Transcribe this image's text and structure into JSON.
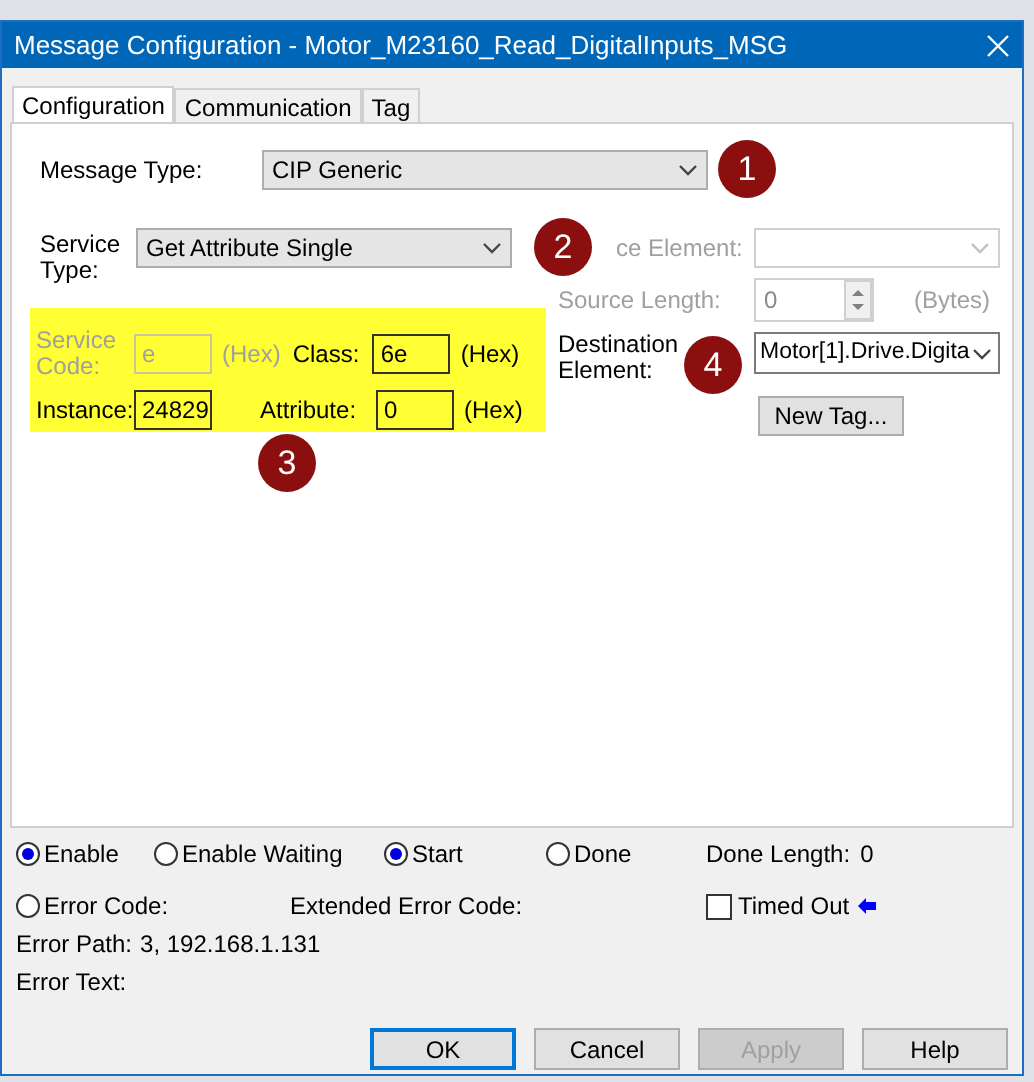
{
  "window": {
    "title": "Message Configuration - Motor_M23160_Read_DigitalInputs_MSG"
  },
  "tabs": [
    {
      "label": "Configuration",
      "selected": true
    },
    {
      "label": "Communication",
      "selected": false
    },
    {
      "label": "Tag",
      "selected": false
    }
  ],
  "message_type": {
    "label": "Message Type:",
    "value": "CIP Generic"
  },
  "service_type": {
    "label": "Service Type:",
    "value": "Get Attribute Single"
  },
  "parameters": [
    {
      "label": "Service Code:",
      "value": "e",
      "unit": "(Hex)",
      "disabled": true
    },
    {
      "label": "Class:",
      "value": "6e",
      "unit": "(Hex)",
      "disabled": false
    },
    {
      "label": "Instance:",
      "value": "24829",
      "disabled": false
    },
    {
      "label": "Attribute:",
      "value": "0",
      "unit": "(Hex)",
      "disabled": false
    }
  ],
  "source_element": {
    "label": "ce Element:",
    "disabled": true
  },
  "source_length": {
    "label": "Source Length:",
    "value": "0",
    "unit": "(Bytes)",
    "disabled": true
  },
  "destination_element": {
    "label": "Destination Element:",
    "value": "Motor[1].Drive.Digita"
  },
  "new_tag_button": "New Tag...",
  "callouts": [
    "1",
    "2",
    "3",
    "4"
  ],
  "status_flags": [
    {
      "label": "Enable",
      "on": true
    },
    {
      "label": "Enable Waiting",
      "on": false
    },
    {
      "label": "Start",
      "on": true
    },
    {
      "label": "Done",
      "on": false
    }
  ],
  "done_length": {
    "label": "Done Length:",
    "value": "0"
  },
  "error_code": {
    "label": "Error Code:",
    "on": false
  },
  "extended_error_code": {
    "label": "Extended Error Code:"
  },
  "timed_out": {
    "label": "Timed Out",
    "checked": false
  },
  "error_path": {
    "label": "Error Path:",
    "value": "3, 192.168.1.131"
  },
  "error_text": {
    "label": "Error Text:"
  },
  "buttons": [
    {
      "label": "OK",
      "disabled": false,
      "focused": true
    },
    {
      "label": "Cancel",
      "disabled": false,
      "focused": false
    },
    {
      "label": "Apply",
      "disabled": true,
      "focused": false
    },
    {
      "label": "Help",
      "disabled": false,
      "focused": false
    }
  ]
}
